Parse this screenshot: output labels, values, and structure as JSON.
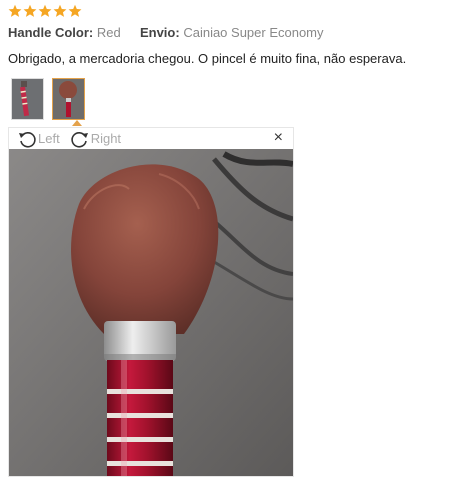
{
  "rating": {
    "stars": 5,
    "color": "#f5a623"
  },
  "attributes": {
    "handle_color_key": "Handle Color:",
    "handle_color_value": "Red",
    "shipping_key": "Envio:",
    "shipping_value": "Cainiao Super Economy"
  },
  "review_text": "Obrigado, a mercadoria chegou. O pincel é muito fina, não esperava.",
  "viewer": {
    "rotate_left_label": "Left",
    "rotate_right_label": "Right",
    "close_label": "×"
  },
  "icons": [
    "star-icon",
    "rotate-left-icon",
    "rotate-right-icon",
    "close-icon"
  ],
  "colors": {
    "accent": "#e4a24a",
    "handle": "#b0122e",
    "bristles": "#8a4a3c"
  }
}
